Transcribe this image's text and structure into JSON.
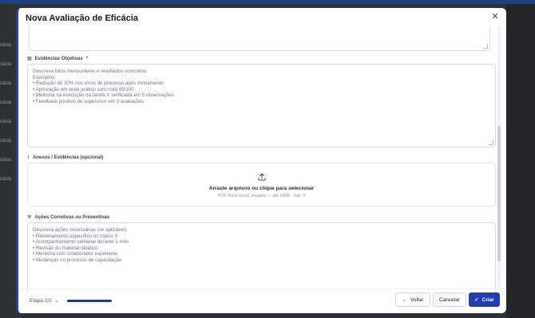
{
  "background": {
    "side_labels": [
      "cácia",
      "cácia",
      "cácia",
      "cácia",
      "cácia",
      "cácia",
      "cácia",
      "cácia",
      "cácia"
    ]
  },
  "modal": {
    "title": "Nova Avaliação de Eficácia",
    "close_icon": "close-icon",
    "fields": {
      "evidencias": {
        "label": "Evidências Objetivas",
        "required_mark": "*",
        "icon": "clipboard-icon",
        "placeholder_lines": [
          "Descreva fatos mensuráveis e resultados concretos:",
          "",
          "Exemplos:",
          "• Redução de 30% nos erros de processo após treinamento",
          "• Aprovação em teste prático com nota 95/100",
          "• Melhoria na execução da tarefa X verificada em 5 observações",
          "• Feedback positivo do supervisor em 3 avaliações"
        ]
      },
      "anexos": {
        "label": "Anexos / Evidências (opcional)",
        "icon": "paperclip-icon",
        "dropzone_title": "Arraste arquivos ou clique para selecionar",
        "dropzone_subtitle": "PDF, Word, Excel, Imagens — até 10MB · máx. 5",
        "upload_icon": "upload-icon"
      },
      "acoes": {
        "label": "Ações Corretivas ou Preventivas",
        "icon": "wrench-icon",
        "placeholder_lines": [
          "Descreva ações necessárias (se aplicável):",
          "",
          "• Retreinamento específico no tópico X",
          "• Acompanhamento semanal durante 1 mês",
          "• Revisão do material didático",
          "• Mentoria com colaborador experiente",
          "• Mudanças no processo de capacitação"
        ]
      }
    },
    "footer": {
      "step_label": "Etapa 2/2",
      "progress": 1.0,
      "back_label": "Voltar",
      "cancel_label": "Cancelar",
      "create_label": "Criar"
    },
    "colors": {
      "primary": "#1e40af",
      "accent_border": "#1e45a0",
      "required": "#dc2626"
    }
  }
}
